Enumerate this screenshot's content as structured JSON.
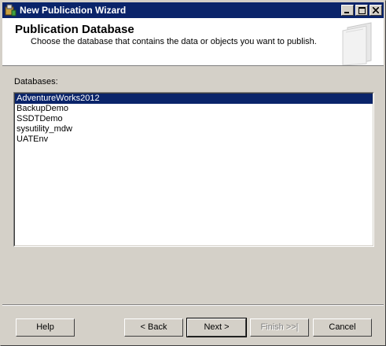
{
  "window": {
    "title": "New Publication Wizard"
  },
  "header": {
    "title": "Publication Database",
    "description": "Choose the database that contains the data or objects you want to publish."
  },
  "databases": {
    "label": "Databases:",
    "items": [
      "AdventureWorks2012",
      "BackupDemo",
      "SSDTDemo",
      "sysutility_mdw",
      "UATEnv"
    ],
    "selected": "AdventureWorks2012"
  },
  "buttons": {
    "help": "Help",
    "back": "< Back",
    "next": "Next >",
    "finish": "Finish >>|",
    "cancel": "Cancel"
  },
  "colors": {
    "titlebar": "#0a246a",
    "selection": "#0a246a",
    "face": "#d4d0c8"
  }
}
